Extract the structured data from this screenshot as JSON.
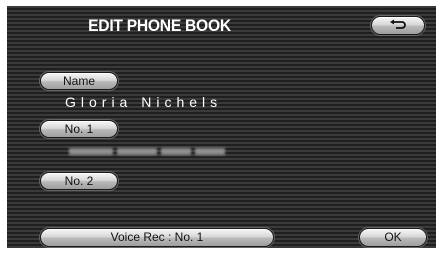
{
  "screen": {
    "title": "EDIT PHONE BOOK",
    "back_icon": "return-arrow-icon"
  },
  "fields": {
    "name_label": "Name",
    "name_value": "Gloria Nichels",
    "no1_label": "No. 1",
    "no1_value_state": "blurred",
    "no2_label": "No. 2",
    "no2_value": ""
  },
  "footer": {
    "voice_rec_label": "Voice Rec : No. 1",
    "ok_label": "OK"
  }
}
